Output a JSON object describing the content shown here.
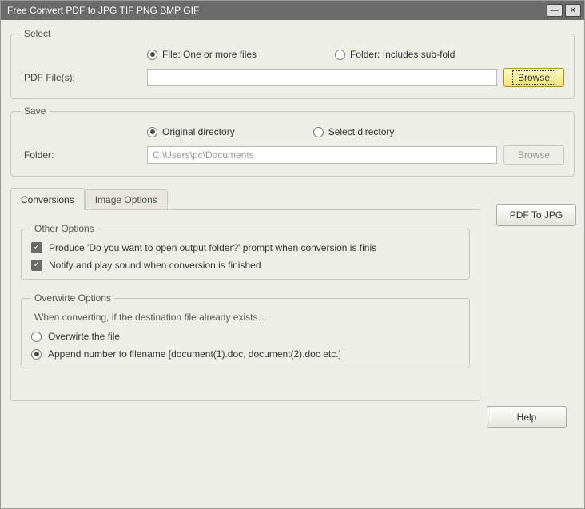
{
  "window": {
    "title": "Free Convert PDF to JPG TIF PNG BMP GIF"
  },
  "select": {
    "legend": "Select",
    "file_radio_label": "File:  One or more files",
    "folder_radio_label": "Folder: Includes sub-fold",
    "file_selected": true,
    "input_label": "PDF File(s):",
    "input_value": "",
    "browse_label": "Browse"
  },
  "save": {
    "legend": "Save",
    "original_radio_label": "Original directory",
    "select_radio_label": "Select directory",
    "original_selected": true,
    "folder_label": "Folder:",
    "folder_value": "C:\\Users\\pc\\Documents",
    "browse_label": "Browse"
  },
  "tabs": {
    "conversions": "Conversions",
    "image_options": "Image Options"
  },
  "side_button": "PDF To JPG",
  "other_options": {
    "legend": "Other Options",
    "opt1_checked": true,
    "opt1_label": "Produce 'Do you want to open output folder?' prompt when conversion is finis",
    "opt2_checked": true,
    "opt2_label": "Notify and play sound when conversion is finished"
  },
  "overwrite": {
    "legend": "Overwirte Options",
    "desc": "When converting, if the destination file already exists…",
    "overwrite_label": "Overwirte the file",
    "append_label": "Append number to filename  [document(1).doc, document(2).doc etc.]",
    "append_selected": true
  },
  "footer": {
    "help_label": "Help"
  }
}
